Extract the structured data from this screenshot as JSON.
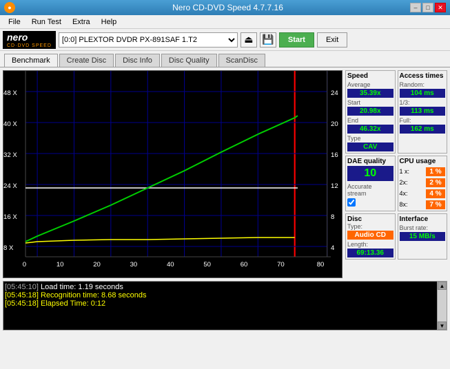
{
  "window": {
    "title": "Nero CD-DVD Speed 4.7.7.16",
    "min_label": "–",
    "max_label": "□",
    "close_label": "✕"
  },
  "menu": {
    "items": [
      "File",
      "Run Test",
      "Extra",
      "Help"
    ]
  },
  "toolbar": {
    "logo_top": "nero",
    "logo_bottom": "CD·DVD SPEED",
    "drive_value": "[0:0]  PLEXTOR DVDR   PX-891SAF 1.T2",
    "start_label": "Start",
    "exit_label": "Exit"
  },
  "tabs": {
    "items": [
      "Benchmark",
      "Create Disc",
      "Disc Info",
      "Disc Quality",
      "ScanDisc"
    ],
    "active": 0
  },
  "speed": {
    "header": "Speed",
    "avg_label": "Average",
    "avg_value": "35.39x",
    "start_label": "Start",
    "start_value": "20.98x",
    "end_label": "End",
    "end_value": "46.32x",
    "type_label": "Type",
    "type_value": "CAV"
  },
  "access": {
    "header": "Access times",
    "random_label": "Random:",
    "random_value": "104 ms",
    "onethird_label": "1/3:",
    "onethird_value": "113 ms",
    "full_label": "Full:",
    "full_value": "162 ms"
  },
  "dae": {
    "header": "DAE quality",
    "value": "10",
    "stream_label": "Accurate",
    "stream_sub": "stream",
    "checked": true
  },
  "cpu": {
    "header": "CPU usage",
    "items": [
      {
        "label": "1 x:",
        "value": "1 %"
      },
      {
        "label": "2x:",
        "value": "2 %"
      },
      {
        "label": "4x:",
        "value": "4 %"
      },
      {
        "label": "8x:",
        "value": "7 %"
      }
    ]
  },
  "disc": {
    "header": "Disc",
    "type_label": "Type:",
    "type_value": "Audio CD",
    "length_label": "Length:",
    "length_value": "69:13.36"
  },
  "interface": {
    "header": "Interface",
    "burst_label": "Burst rate:",
    "burst_value": "15 MB/s"
  },
  "chart": {
    "x_labels": [
      "0",
      "10",
      "20",
      "30",
      "40",
      "50",
      "60",
      "70",
      "80"
    ],
    "y_labels_left": [
      "48 X",
      "40 X",
      "32 X",
      "24 X",
      "16 X",
      "8 X",
      ""
    ],
    "y_labels_right": [
      "24",
      "20",
      "16",
      "12",
      "8",
      "4",
      ""
    ]
  },
  "log": {
    "lines": [
      {
        "time": "[05:45:10]",
        "text": " Load time: 1.19 seconds",
        "color": "white"
      },
      {
        "time": "[05:45:18]",
        "text": " Recognition time: 8.68 seconds",
        "color": "yellow"
      },
      {
        "time": "[05:45:18]",
        "text": " Elapsed Time: 0:12",
        "color": "yellow"
      }
    ]
  }
}
